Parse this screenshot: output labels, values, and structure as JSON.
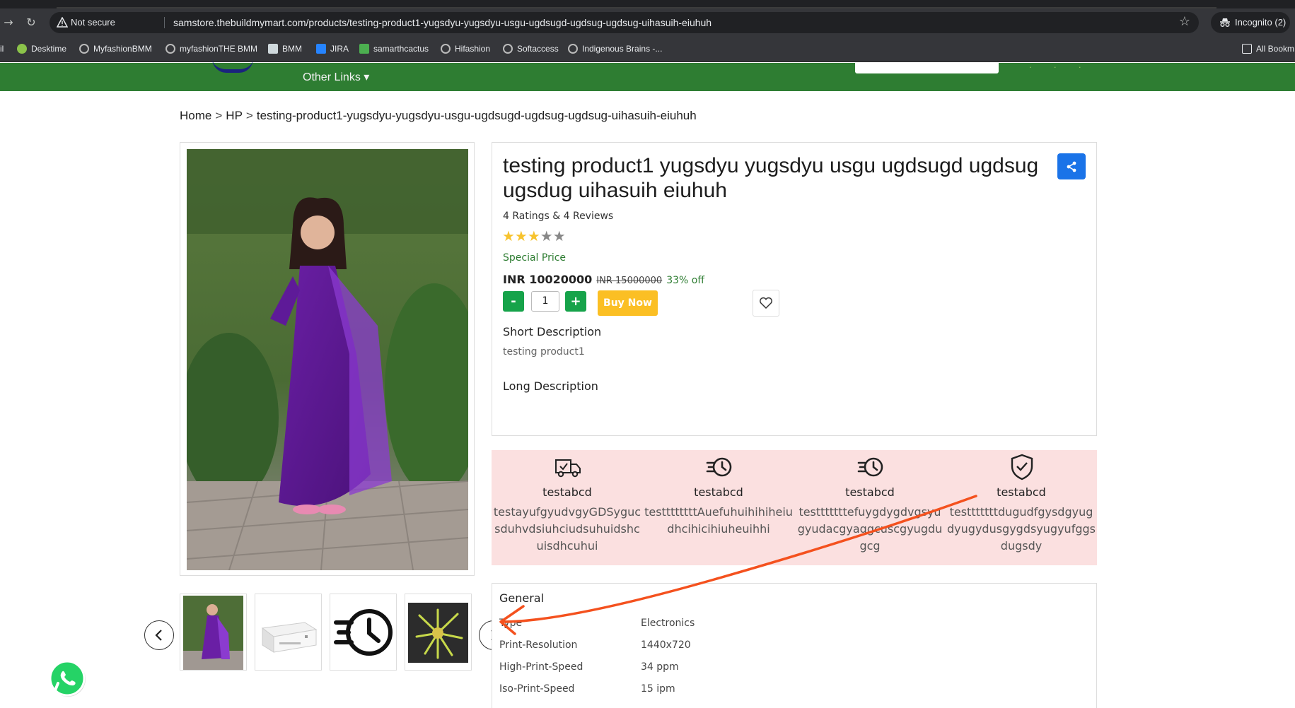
{
  "browser": {
    "not_secure": "Not secure",
    "url": "samstore.thebuildmymart.com/products/testing-product1-yugsdyu-yugsdyu-usgu-ugdsugd-ugdsug-ugdsug-uihasuih-eiuhuh",
    "incognito_label": "Incognito (2)",
    "bookmarks": [
      {
        "label": "il"
      },
      {
        "label": "Desktime"
      },
      {
        "label": "MyfashionBMM"
      },
      {
        "label": "myfashionTHE BMM"
      },
      {
        "label": "BMM"
      },
      {
        "label": "JIRA"
      },
      {
        "label": "samarthcactus"
      },
      {
        "label": "Hifashion"
      },
      {
        "label": "Softaccess"
      },
      {
        "label": "Indigenous Brains -..."
      },
      {
        "label": "All Bookm"
      }
    ]
  },
  "header": {
    "other_links": "Other Links ▾",
    "bg_color": "#2e7d32"
  },
  "breadcrumb": {
    "home": "Home",
    "category": "HP",
    "current": "testing-product1-yugsdyu-yugsdyu-usgu-ugdsugd-ugdsug-ugdsug-uihasuih-eiuhuh",
    "separator": ">"
  },
  "product": {
    "title": "testing product1 yugsdyu yugsdyu usgu ugdsugd ugdsug ugsdug uihasuih eiuhuh",
    "ratings_text": "4 Ratings & 4 Reviews",
    "rating": 3,
    "rating_max": 5,
    "stars_on": "★★★",
    "stars_off": "★★",
    "special_price_label": "Special Price",
    "price": "INR 10020000",
    "mrp": "INR 15000000",
    "discount": "33% off",
    "qty_minus": "-",
    "qty_value": "1",
    "qty_plus": "+",
    "buy_now": "Buy Now",
    "short_desc_heading": "Short Description",
    "short_desc": "testing product1",
    "long_desc_heading": "Long Description"
  },
  "features": [
    {
      "icon": "delivery-truck-icon",
      "title": "testabcd",
      "text": "testayufgyudvgyGDSygucsduhvdsiuhciudsuhuidshcuisdhcuhui"
    },
    {
      "icon": "fast-clock-icon",
      "title": "testabcd",
      "text": "testtttttttAuefuhuihihiheiudhcihicihiuheuihhi"
    },
    {
      "icon": "fast-clock-icon",
      "title": "testabcd",
      "text": "testttttttefuygdygdvgsyugyudacgyaggcuscgyugdugcg"
    },
    {
      "icon": "shield-check-icon",
      "title": "testabcd",
      "text": "testttttttdugudfgysdgyugdyugydusgygdsyugyufggsdugsdy"
    }
  ],
  "specs": {
    "group_title": "General",
    "rows": [
      {
        "key": "Type",
        "value": "Electronics"
      },
      {
        "key": "Print-Resolution",
        "value": "1440x720"
      },
      {
        "key": "High-Print-Speed",
        "value": "34 ppm"
      },
      {
        "key": "Iso-Print-Speed",
        "value": "15 ipm"
      }
    ]
  },
  "colors": {
    "accent_green": "#16a34a",
    "buy_now": "#fbbf24",
    "share_blue": "#1a73e8",
    "features_bg": "#fbe0e0",
    "annotation_orange": "#f4511e"
  }
}
